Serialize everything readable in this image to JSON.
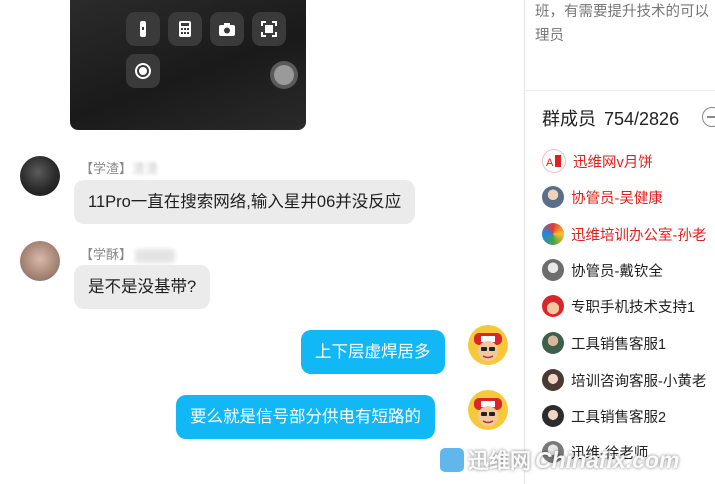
{
  "chat": {
    "messages": [
      {
        "type": "image",
        "content": "screenshot-control-center"
      },
      {
        "sender_tag": "【学渣】",
        "sender_name": "渣渣",
        "text": "11Pro一直在搜索网络,输入星井06并没反应",
        "direction": "in"
      },
      {
        "sender_tag": "【学酥】",
        "sender_name": "",
        "text": "是不是没基带?",
        "direction": "in"
      },
      {
        "text": "上下层虚焊居多",
        "direction": "out"
      },
      {
        "text": "要么就是信号部分供电有短路的",
        "direction": "out"
      }
    ]
  },
  "side": {
    "notice_line1": "班，有需要提升技术的可以",
    "notice_line2": "理员",
    "members_label": "群成员",
    "members_count": "754/2826",
    "members": [
      {
        "name": "迅维网v月饼",
        "color": "#e02020",
        "avatar": "red-logo"
      },
      {
        "name": "协管员-吴健康",
        "color": "#e02020",
        "avatar": "person"
      },
      {
        "name": "迅维培训办公室-孙老",
        "color": "#e02020",
        "avatar": "colorful"
      },
      {
        "name": "协管员-戴钦全",
        "color": "#222222",
        "avatar": "person"
      },
      {
        "name": "专职手机技术支持1",
        "color": "#222222",
        "avatar": "cartoon"
      },
      {
        "name": "工具销售客服1",
        "color": "#222222",
        "avatar": "person"
      },
      {
        "name": "培训咨询客服-小黄老",
        "color": "#222222",
        "avatar": "woman"
      },
      {
        "name": "工具销售客服2",
        "color": "#222222",
        "avatar": "woman"
      },
      {
        "name": "迅维-徐老师",
        "color": "#222222",
        "avatar": "person"
      }
    ]
  },
  "watermark": {
    "cn": "迅维网",
    "en": "Chinafix.com"
  },
  "colors": {
    "bubble_out": "#12b7f5",
    "bubble_in": "#ebebeb",
    "admin_red": "#e02020"
  }
}
